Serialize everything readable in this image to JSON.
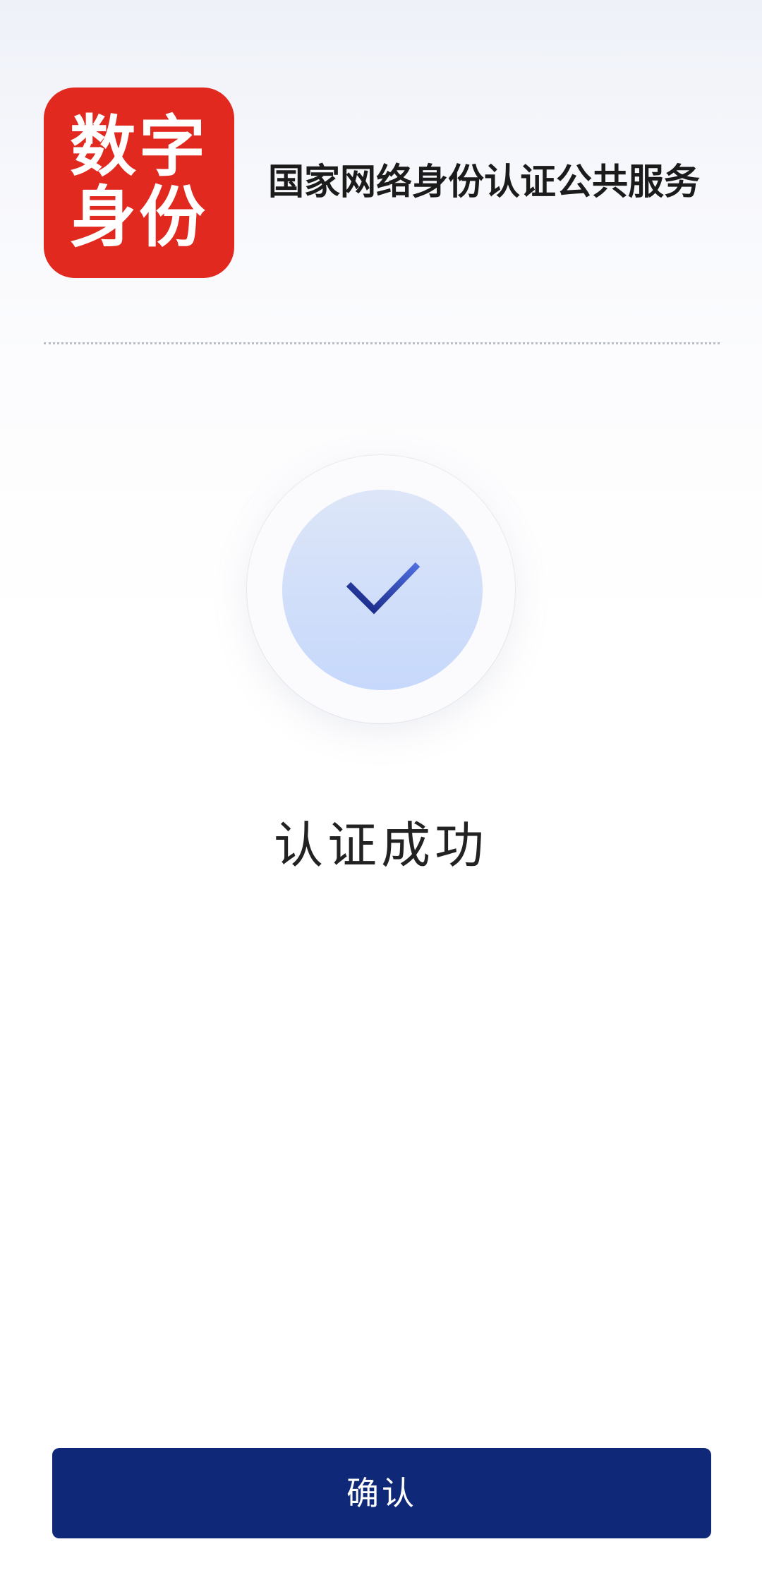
{
  "header": {
    "logo": {
      "line1": "数字",
      "line2": "身份",
      "color": "#e2291f"
    },
    "service_title": "国家网络身份认证公共服务"
  },
  "result": {
    "icon": "checkmark-icon",
    "status_text": "认证成功"
  },
  "footer": {
    "confirm_label": "确认",
    "button_color": "#0f2878"
  }
}
